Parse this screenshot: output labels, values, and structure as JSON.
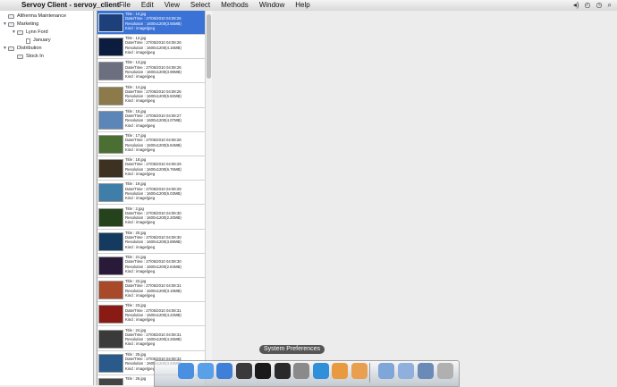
{
  "menubar": {
    "apple": "",
    "app_name": "Servoy Client - servoy_client",
    "menus": [
      "File",
      "Edit",
      "View",
      "Select",
      "Methods",
      "Window",
      "Help"
    ]
  },
  "tree": [
    {
      "label": "Altherma Maintenance",
      "depth": 0,
      "expandable": false,
      "expanded": false
    },
    {
      "label": "Marketing",
      "depth": 0,
      "expandable": true,
      "expanded": true
    },
    {
      "label": "Lynn Ford",
      "depth": 1,
      "expandable": true,
      "expanded": true
    },
    {
      "label": "January",
      "depth": 2,
      "expandable": false,
      "expanded": false
    },
    {
      "label": "Distribution",
      "depth": 0,
      "expandable": true,
      "expanded": true
    },
    {
      "label": "Stock In",
      "depth": 1,
      "expandable": false,
      "expanded": false
    }
  ],
  "images": [
    {
      "title": "Title : 10.jpg",
      "date": "Date/Time : 27/05/2010 04:08:25",
      "resolution": "Resolution : 1600x1200(3.55MB)",
      "kind": "Kind : image/jpeg",
      "selected": true,
      "thumb_color": "#1d3f7a"
    },
    {
      "title": "Title : 12.jpg",
      "date": "Date/Time : 27/05/2010 04:08:26",
      "resolution": "Resolution : 1600x1200(4.16MB)",
      "kind": "Kind : image/jpeg",
      "selected": false,
      "thumb_color": "#0b1c3e"
    },
    {
      "title": "Title : 13.jpg",
      "date": "Date/Time : 27/05/2010 04:08:26",
      "resolution": "Resolution : 1600x1200(3.98MB)",
      "kind": "Kind : image/jpeg",
      "selected": false,
      "thumb_color": "#6c6f80"
    },
    {
      "title": "Title : 14.jpg",
      "date": "Date/Time : 27/05/2010 04:08:26",
      "resolution": "Resolution : 1600x1200(5.82MB)",
      "kind": "Kind : image/jpeg",
      "selected": false,
      "thumb_color": "#8c7a4a"
    },
    {
      "title": "Title : 15.jpg",
      "date": "Date/Time : 27/05/2010 04:08:27",
      "resolution": "Resolution : 1600x1200(4.07MB)",
      "kind": "Kind : image/jpeg",
      "selected": false,
      "thumb_color": "#5d86b8"
    },
    {
      "title": "Title : 17.jpg",
      "date": "Date/Time : 27/05/2010 04:08:28",
      "resolution": "Resolution : 1600x1200(5.84MB)",
      "kind": "Kind : image/jpeg",
      "selected": false,
      "thumb_color": "#4b6e32"
    },
    {
      "title": "Title : 18.jpg",
      "date": "Date/Time : 27/05/2010 04:08:29",
      "resolution": "Resolution : 1600x1200(6.76MB)",
      "kind": "Kind : image/jpeg",
      "selected": false,
      "thumb_color": "#3d3222"
    },
    {
      "title": "Title : 19.jpg",
      "date": "Date/Time : 27/05/2010 04:08:29",
      "resolution": "Resolution : 1600x1200(6.03MB)",
      "kind": "Kind : image/jpeg",
      "selected": false,
      "thumb_color": "#3f7ea8"
    },
    {
      "title": "Title : 2.jpg",
      "date": "Date/Time : 27/05/2010 04:08:30",
      "resolution": "Resolution : 1600x1200(2.20MB)",
      "kind": "Kind : image/jpeg",
      "selected": false,
      "thumb_color": "#24421c"
    },
    {
      "title": "Title : 20.jpg",
      "date": "Date/Time : 27/05/2010 04:08:30",
      "resolution": "Resolution : 1600x1200(3.89MB)",
      "kind": "Kind : image/jpeg",
      "selected": false,
      "thumb_color": "#153a60"
    },
    {
      "title": "Title : 21.jpg",
      "date": "Date/Time : 27/05/2010 04:08:30",
      "resolution": "Resolution : 1600x1200(2.84MB)",
      "kind": "Kind : image/jpeg",
      "selected": false,
      "thumb_color": "#2a1a3a"
    },
    {
      "title": "Title : 22.jpg",
      "date": "Date/Time : 27/05/2010 04:08:31",
      "resolution": "Resolution : 1600x1200(3.19MB)",
      "kind": "Kind : image/jpeg",
      "selected": false,
      "thumb_color": "#a8492a"
    },
    {
      "title": "Title : 23.jpg",
      "date": "Date/Time : 27/05/2010 04:08:31",
      "resolution": "Resolution : 1600x1200(4.22MB)",
      "kind": "Kind : image/jpeg",
      "selected": false,
      "thumb_color": "#8a1a14"
    },
    {
      "title": "Title : 24.jpg",
      "date": "Date/Time : 27/05/2010 04:08:31",
      "resolution": "Resolution : 1600x1200(4.25MB)",
      "kind": "Kind : image/jpeg",
      "selected": false,
      "thumb_color": "#3a3a3a"
    },
    {
      "title": "Title : 25.jpg",
      "date": "Date/Time : 27/05/2010 04:08:32",
      "resolution": "Resolution : 1600x1200(3.93MB)",
      "kind": "Kind : image/jpeg",
      "selected": false,
      "thumb_color": "#2a5a8a"
    },
    {
      "title": "Title : 26.jpg",
      "date": "",
      "resolution": "",
      "kind": "",
      "selected": false,
      "thumb_color": "#444444"
    }
  ],
  "dock": {
    "tooltip": "System Preferences",
    "icons": [
      {
        "name": "finder-icon",
        "color": "#4b8fe0"
      },
      {
        "name": "safari-icon",
        "color": "#5aa0e8"
      },
      {
        "name": "ichat-icon",
        "color": "#3f7fd8"
      },
      {
        "name": "dashboard-icon",
        "color": "#3a3a3a"
      },
      {
        "name": "terminal-icon",
        "color": "#1a1a1a"
      },
      {
        "name": "activity-monitor-icon",
        "color": "#2a2a2a"
      },
      {
        "name": "system-preferences-icon",
        "color": "#8a8a8a"
      },
      {
        "name": "quicktime-icon",
        "color": "#2f8fd8"
      },
      {
        "name": "app-orange-icon",
        "color": "#e89a40"
      },
      {
        "name": "app-orange-2-icon",
        "color": "#e8a050"
      },
      {
        "name": "applications-folder-icon",
        "color": "#7fa6d8"
      },
      {
        "name": "documents-folder-icon",
        "color": "#8fb0dc"
      },
      {
        "name": "preview-icon",
        "color": "#6a8ab8"
      },
      {
        "name": "trash-icon",
        "color": "#b0b0b0"
      }
    ]
  }
}
